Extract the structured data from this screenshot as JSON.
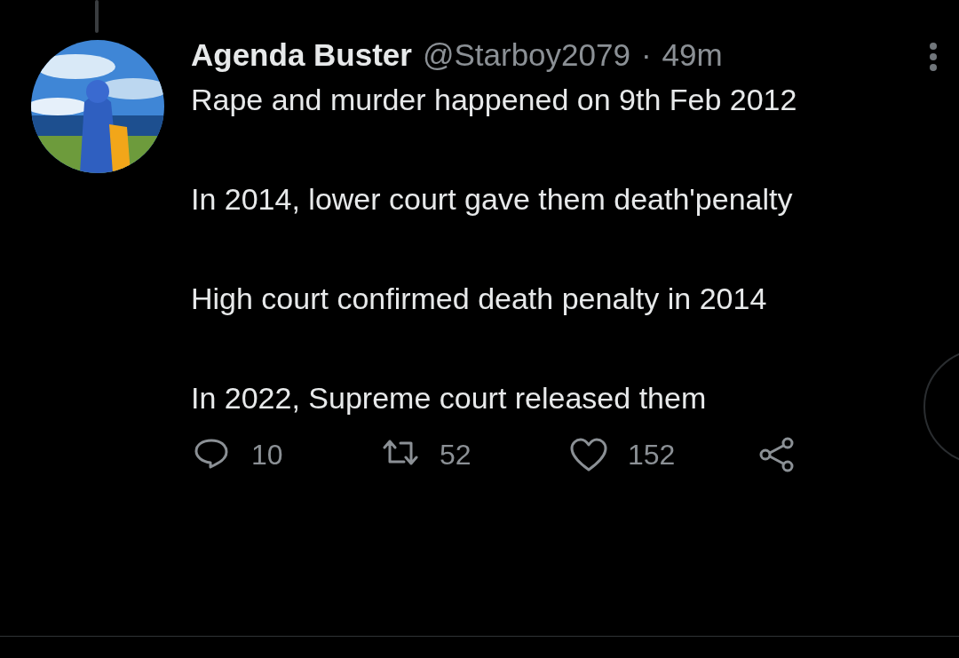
{
  "tweet": {
    "author_name": "Agenda Buster",
    "handle": "@Starboy2079",
    "separator": "·",
    "time": "49m",
    "paragraphs": [
      "Rape and murder happened on 9th Feb 2012",
      "In 2014, lower court gave them death'penalty",
      "High court confirmed death penalty in 2014",
      "In 2022, Supreme court released them"
    ],
    "actions": [
      {
        "kind": "reply",
        "count": "10"
      },
      {
        "kind": "retweet",
        "count": "52"
      },
      {
        "kind": "like",
        "count": "152"
      },
      {
        "kind": "share"
      }
    ]
  }
}
